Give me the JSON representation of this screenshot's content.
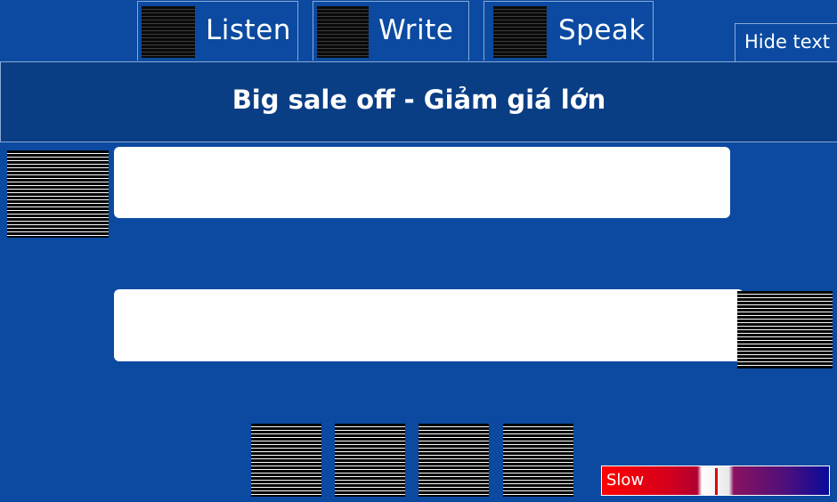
{
  "tabs": [
    {
      "label": "Listen",
      "icon": "listen-image"
    },
    {
      "label": "Write",
      "icon": "write-image"
    },
    {
      "label": "Speak",
      "icon": "speak-image"
    }
  ],
  "hide_text_label": "Hide text",
  "lesson_title": "Big sale off - Giảm giá lớn",
  "dialogue": {
    "line_1": "",
    "line_2": ""
  },
  "playback_controls": [
    "control-button-1",
    "control-button-2",
    "control-button-3",
    "control-button-4"
  ],
  "speed": {
    "label": "Slow",
    "value_fraction": 0.5
  },
  "colors": {
    "background": "#0b4aa0",
    "title_bar": "#093e84",
    "border": "#8aa9d6",
    "bubble": "#ffffff"
  }
}
